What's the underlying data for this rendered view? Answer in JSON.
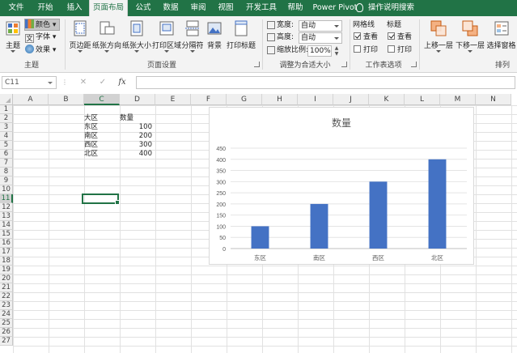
{
  "tabs": [
    "文件",
    "开始",
    "插入",
    "页面布局",
    "公式",
    "数据",
    "审阅",
    "视图",
    "开发工具",
    "帮助",
    "Power Pivot"
  ],
  "active_tab": "页面布局",
  "tell_me": "操作说明搜索",
  "ribbon": {
    "theme_group": {
      "label": "主题",
      "themes_label": "主题",
      "colors_label": "颜色",
      "fonts_label": "字体",
      "effects_label": "效果"
    },
    "page_setup_group": {
      "label": "页面设置",
      "margins_label": "页边距",
      "orientation_label": "纸张方向",
      "size_label": "纸张大小",
      "print_area_label": "打印区域",
      "breaks_label": "分隔符",
      "background_label": "背景",
      "print_titles_label": "打印标题"
    },
    "scale_group": {
      "label": "调整为合适大小",
      "width_label": "宽度:",
      "width_value": "自动",
      "height_label": "高度:",
      "height_value": "自动",
      "scale_label": "缩放比例:",
      "scale_value": "100%"
    },
    "sheet_options_group": {
      "label": "工作表选项",
      "gridlines_label": "网格线",
      "headings_label": "标题",
      "view_label": "查看",
      "print_label": "打印"
    },
    "arrange_group": {
      "label": "排列",
      "bring_forward_label": "上移一层",
      "send_backward_label": "下移一层",
      "selection_pane_label": "选择窗格"
    }
  },
  "formula_bar": {
    "name_box": "C11",
    "fx": "fx",
    "formula": ""
  },
  "columns": [
    "A",
    "B",
    "C",
    "D",
    "E",
    "F",
    "G",
    "H",
    "I",
    "J",
    "K",
    "L",
    "M",
    "N"
  ],
  "selected_column": "C",
  "rows": [
    "1",
    "2",
    "3",
    "4",
    "5",
    "6",
    "7",
    "8",
    "9",
    "10",
    "11",
    "12",
    "13",
    "14",
    "15",
    "16",
    "17",
    "18",
    "19",
    "20",
    "21",
    "22",
    "23",
    "24",
    "25",
    "26",
    "27"
  ],
  "selected_row": "11",
  "table": {
    "headers": [
      "大区",
      "数量"
    ],
    "rows": [
      [
        "东区",
        "100"
      ],
      [
        "南区",
        "200"
      ],
      [
        "西区",
        "300"
      ],
      [
        "北区",
        "400"
      ]
    ]
  },
  "chart_data": {
    "type": "bar",
    "title": "数量",
    "categories": [
      "东区",
      "南区",
      "西区",
      "北区"
    ],
    "values": [
      100,
      200,
      300,
      400
    ],
    "ylim": [
      0,
      450
    ],
    "yticks": [
      0,
      50,
      100,
      150,
      200,
      250,
      300,
      350,
      400,
      450
    ],
    "bar_color": "#4472C4",
    "grid": true,
    "legend": "none"
  },
  "colors": {
    "brand": "#217346",
    "ribbon_bg": "#f3f3f3"
  }
}
